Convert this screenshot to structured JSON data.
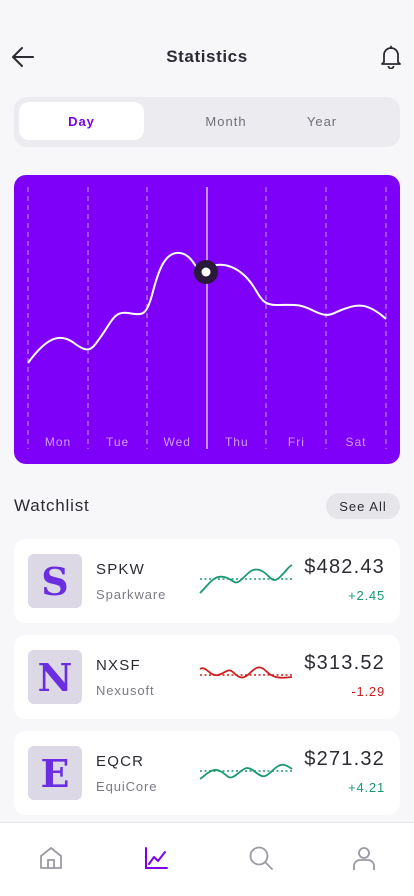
{
  "header": {
    "title": "Statistics",
    "back_icon": "arrow-left-icon",
    "bell_icon": "bell-icon"
  },
  "tabs": [
    {
      "label": "Day",
      "active": true
    },
    {
      "label": "Month",
      "active": false
    },
    {
      "label": "Year",
      "active": false
    }
  ],
  "chart_data": {
    "type": "line",
    "x": [
      "Mon",
      "Tue",
      "Wed",
      "Thu",
      "Fri",
      "Sat"
    ],
    "selected_index": 3,
    "grid": "vertical dashed",
    "colors": {
      "background": "#7f00f9",
      "line": "#ffffff",
      "marker": "#2a1a3a"
    }
  },
  "watchlist": {
    "title": "Watchlist",
    "see_all": "See All",
    "items": [
      {
        "logo_letter": "S",
        "ticker": "SPKW",
        "company": "Sparkware",
        "price": "$482.43",
        "change": "+2.45",
        "trend": "up",
        "color": "#1a9a6c"
      },
      {
        "logo_letter": "N",
        "ticker": "NXSF",
        "company": "Nexusoft",
        "price": "$313.52",
        "change": "-1.29",
        "trend": "down",
        "color": "#cc1f1f"
      },
      {
        "logo_letter": "E",
        "ticker": "EQCR",
        "company": "EquiCore",
        "price": "$271.32",
        "change": "+4.21",
        "trend": "up",
        "color": "#1a9a6c"
      }
    ]
  },
  "bottom_nav": {
    "items": [
      {
        "icon": "home-icon",
        "active": false
      },
      {
        "icon": "chart-icon",
        "active": true
      },
      {
        "icon": "search-icon",
        "active": false
      },
      {
        "icon": "profile-icon",
        "active": false
      }
    ],
    "active_color": "#7c00e8",
    "inactive_color": "#9a9aa3"
  }
}
